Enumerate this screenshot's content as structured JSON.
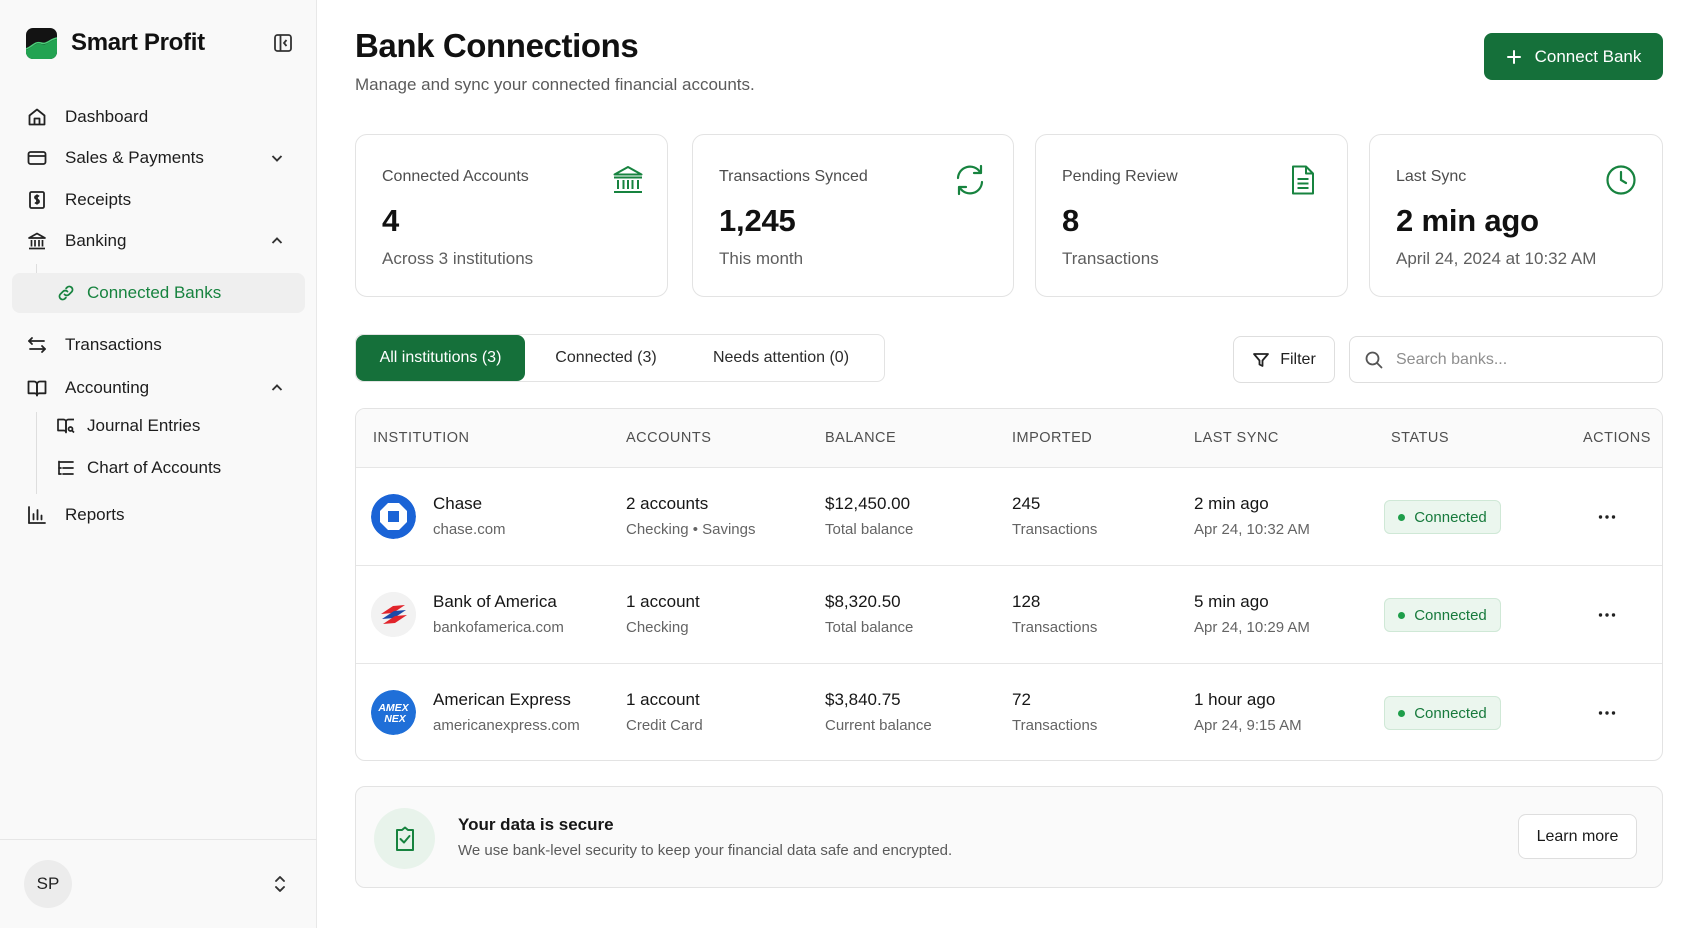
{
  "app": {
    "name": "Smart Profit"
  },
  "sidebar": {
    "items": [
      {
        "label": "Dashboard",
        "icon": "home-icon"
      },
      {
        "label": "Sales & Payments",
        "icon": "credit-card-icon"
      },
      {
        "label": "Receipts",
        "icon": "receipt-icon"
      },
      {
        "label": "Banking",
        "icon": "bank-icon"
      },
      {
        "label": "Connected Banks",
        "icon": "link-icon"
      },
      {
        "label": "Transactions",
        "icon": "arrows-left-right-icon"
      },
      {
        "label": "Accounting",
        "icon": "book-open-icon"
      },
      {
        "label": "Journal Entries",
        "icon": "book-icon"
      },
      {
        "label": "Chart of Accounts",
        "icon": "list-tree-icon"
      },
      {
        "label": "Reports",
        "icon": "bar-chart-icon"
      }
    ],
    "user": {
      "initials": "SP"
    }
  },
  "header": {
    "title": "Bank Connections",
    "subtitle": "Manage and sync your connected financial accounts.",
    "connect_label": "Connect Bank"
  },
  "stats": [
    {
      "label": "Connected Accounts",
      "value": "4",
      "sub": "Across 3 institutions",
      "icon": "bank-icon"
    },
    {
      "label": "Transactions Synced",
      "value": "1,245",
      "sub": "This month",
      "icon": "refresh-icon"
    },
    {
      "label": "Pending Review",
      "value": "8",
      "sub": "Transactions",
      "icon": "document-icon"
    },
    {
      "label": "Last Sync",
      "value": "2 min ago",
      "sub": "April 24, 2024 at 10:32 AM",
      "icon": "clock-icon"
    }
  ],
  "tabs": [
    {
      "label": "All institutions (3)",
      "active": true
    },
    {
      "label": "Connected (3)",
      "active": false
    },
    {
      "label": "Needs attention (0)",
      "active": false
    }
  ],
  "filter_label": "Filter",
  "search": {
    "placeholder": "Search banks..."
  },
  "table": {
    "columns": [
      "INSTITUTION",
      "ACCOUNTS",
      "BALANCE",
      "IMPORTED",
      "LAST SYNC",
      "STATUS",
      "ACTIONS"
    ],
    "rows": [
      {
        "name": "Chase",
        "domain": "chase.com",
        "accounts": "2 accounts",
        "account_types": "Checking • Savings",
        "balance": "$12,450.00",
        "balance_label": "Total balance",
        "imported": "245",
        "imported_label": "Transactions",
        "last_sync": "2 min ago",
        "last_sync_date": "Apr 24, 10:32 AM",
        "status": "Connected"
      },
      {
        "name": "Bank of America",
        "domain": "bankofamerica.com",
        "accounts": "1 account",
        "account_types": "Checking",
        "balance": "$8,320.50",
        "balance_label": "Total balance",
        "imported": "128",
        "imported_label": "Transactions",
        "last_sync": "5 min ago",
        "last_sync_date": "Apr 24, 10:29 AM",
        "status": "Connected"
      },
      {
        "name": "American Express",
        "domain": "americanexpress.com",
        "accounts": "1 account",
        "account_types": "Credit Card",
        "balance": "$3,840.75",
        "balance_label": "Current balance",
        "imported": "72",
        "imported_label": "Transactions",
        "last_sync": "1 hour ago",
        "last_sync_date": "Apr 24, 9:15 AM",
        "status": "Connected"
      }
    ]
  },
  "security": {
    "title": "Your data is secure",
    "text": "We use bank-level security to keep your financial data safe and encrypted.",
    "learn_more": "Learn more",
    "amex_logo_text": [
      "AMEX",
      "NEX"
    ]
  },
  "colors": {
    "brand_green": "#15703a",
    "accent_green": "#17833f",
    "status_bg": "#ebf6ee",
    "chase_blue": "#1a63d6",
    "amex_blue": "#1f6fd8"
  }
}
